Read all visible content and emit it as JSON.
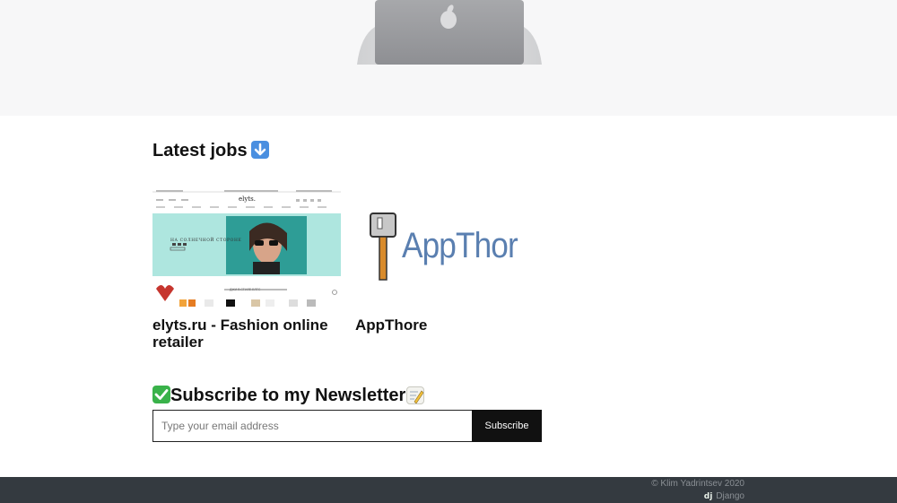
{
  "colors": {
    "hero_bg": "#f7f7f8",
    "footer_bg": "#343a40",
    "button_bg": "#111111",
    "teal_banner": "#aee6df",
    "apphor_text": "#5a7fb0"
  },
  "hero": {
    "image_icon": "laptop-apple-icon"
  },
  "latest_jobs": {
    "heading": "Latest jobs",
    "emoji_icon": "down-arrow-emoji-icon",
    "jobs": [
      {
        "title": "elyts.ru - Fashion online retailer",
        "thumb": {
          "logo": "elyts.",
          "banner_text": "НА СОЛНЕЧНОЙ СТОРОНЕ",
          "section_text": "ДЖИ В СТИЛЕ ЕЛТС"
        }
      },
      {
        "title": "AppThore",
        "thumb": {
          "logo_text": "AppThor"
        }
      }
    ]
  },
  "newsletter": {
    "heading": "Subscribe to my Newsletter",
    "check_icon": "check-mark-emoji-icon",
    "memo_icon": "memo-emoji-icon",
    "email_placeholder": "Type your email address",
    "subscribe_label": "Subscribe"
  },
  "footer": {
    "copyright": "© Klim Yadrintsev 2020",
    "django_logo": "dj",
    "django_label": "Django"
  }
}
